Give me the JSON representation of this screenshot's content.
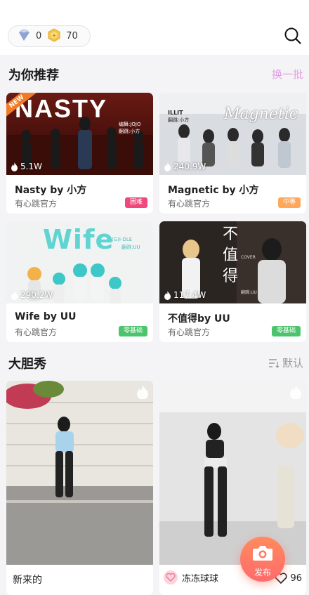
{
  "header": {
    "diamond_count": "0",
    "coin_count": "70"
  },
  "recommend": {
    "title": "为你推荐",
    "refresh_label": "换一批",
    "cards": [
      {
        "title": "Nasty by 小方",
        "author": "有心跳官方",
        "plays": "5.1W",
        "level": "困难",
        "level_color": "#f0487a",
        "badge": "NEW",
        "art_text": "NASTY",
        "art_credit1": "编舞:JOJO",
        "art_credit2": "翻跳:小方"
      },
      {
        "title": "Magnetic by 小方",
        "author": "有心跳官方",
        "plays": "240.9W",
        "level": "中等",
        "level_color": "#ffa85c",
        "art_text": "Magnetic",
        "art_credit1": "ILLIT",
        "art_credit2": "翻跳:小方"
      },
      {
        "title": "Wife by UU",
        "author": "有心跳官方",
        "plays": "290.2W",
        "level": "零基础",
        "level_color": "#4cc46d",
        "art_text": "Wife",
        "art_credit1": "(G)I-DLE",
        "art_credit2": "翻跳:UU"
      },
      {
        "title": "不值得by UU",
        "author": "有心跳官方",
        "plays": "117.4W",
        "level": "零基础",
        "level_color": "#4cc46d",
        "art_text": "不值得",
        "art_credit1": "COVER",
        "art_credit2": "翻跳:UU"
      }
    ]
  },
  "show": {
    "title": "大胆秀",
    "sort_label": "默认",
    "posts": [
      {
        "caption": "新来的"
      },
      {
        "user": "冻冻球球",
        "likes": "96"
      }
    ]
  },
  "fab": {
    "label": "发布"
  },
  "colors": {
    "accent_pink": "#e29de0",
    "fab": "#ff7a62"
  }
}
